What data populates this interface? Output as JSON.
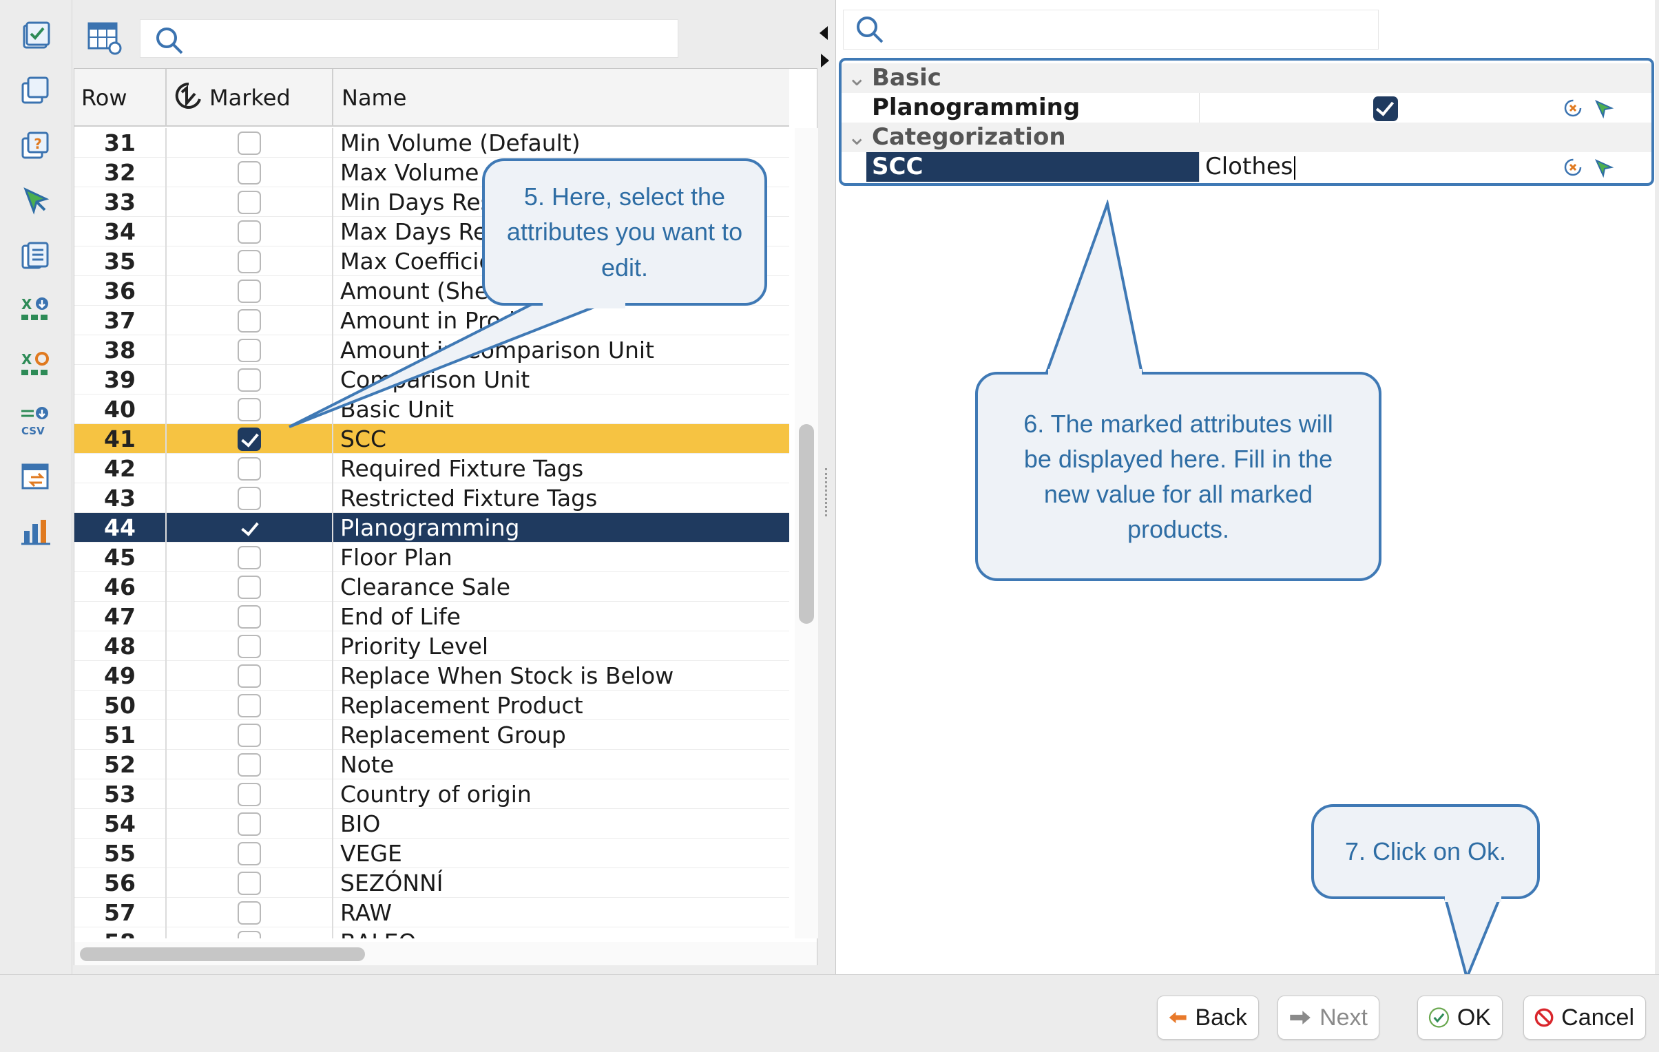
{
  "left_search": {
    "placeholder": ""
  },
  "table": {
    "headers": {
      "row": "Row",
      "marked": "Marked",
      "name": "Name"
    },
    "rows": [
      {
        "row": "31",
        "marked": false,
        "name": "Min Volume (Default)"
      },
      {
        "row": "32",
        "marked": false,
        "name": "Max Volume ("
      },
      {
        "row": "33",
        "marked": false,
        "name": "Min Days Rese"
      },
      {
        "row": "34",
        "marked": false,
        "name": "Max Days Res"
      },
      {
        "row": "35",
        "marked": false,
        "name": "Max Coefficier"
      },
      {
        "row": "36",
        "marked": false,
        "name": "Amount (Shelf"
      },
      {
        "row": "37",
        "marked": false,
        "name": "Amount in Prod"
      },
      {
        "row": "38",
        "marked": false,
        "name": "Amount in Comparison Unit"
      },
      {
        "row": "39",
        "marked": false,
        "name": "Comparison Unit"
      },
      {
        "row": "40",
        "marked": false,
        "name": "Basic Unit"
      },
      {
        "row": "41",
        "marked": true,
        "name": "SCC"
      },
      {
        "row": "42",
        "marked": false,
        "name": "Required Fixture Tags"
      },
      {
        "row": "43",
        "marked": false,
        "name": "Restricted Fixture Tags"
      },
      {
        "row": "44",
        "marked": true,
        "name": "Planogramming"
      },
      {
        "row": "45",
        "marked": false,
        "name": "Floor Plan"
      },
      {
        "row": "46",
        "marked": false,
        "name": "Clearance Sale"
      },
      {
        "row": "47",
        "marked": false,
        "name": "End of Life"
      },
      {
        "row": "48",
        "marked": false,
        "name": "Priority Level"
      },
      {
        "row": "49",
        "marked": false,
        "name": "Replace When Stock is Below"
      },
      {
        "row": "50",
        "marked": false,
        "name": "Replacement Product"
      },
      {
        "row": "51",
        "marked": false,
        "name": "Replacement Group"
      },
      {
        "row": "52",
        "marked": false,
        "name": "Note"
      },
      {
        "row": "53",
        "marked": false,
        "name": "Country of origin"
      },
      {
        "row": "54",
        "marked": false,
        "name": "BIO"
      },
      {
        "row": "55",
        "marked": false,
        "name": "VEGE"
      },
      {
        "row": "56",
        "marked": false,
        "name": "SEZÓNNÍ"
      },
      {
        "row": "57",
        "marked": false,
        "name": "RAW"
      },
      {
        "row": "58",
        "marked": false,
        "name": "BALEO"
      }
    ],
    "highlight_yellow_row": "41",
    "highlight_dark_row": "44"
  },
  "right_search": {
    "placeholder": ""
  },
  "properties": {
    "groups": [
      {
        "label": "Basic",
        "items": [
          {
            "name": "Planogramming",
            "type": "checkbox",
            "checked": true
          }
        ]
      },
      {
        "label": "Categorization",
        "items": [
          {
            "name": "SCC",
            "type": "text",
            "value": "Clothes"
          }
        ]
      }
    ]
  },
  "callouts": {
    "c5": "5. Here, select the attributes you want to edit.",
    "c6": "6. The marked attributes will be displayed here. Fill in the new value for all marked products.",
    "c7": "7. Click on Ok."
  },
  "buttons": {
    "back": "Back",
    "next": "Next",
    "ok": "OK",
    "cancel": "Cancel"
  },
  "colors": {
    "accent_dark": "#1f3a5f",
    "highlight_yellow": "#f6c342",
    "callout_border": "#3f79b5",
    "callout_text": "#2e6da4"
  },
  "icons": {
    "toolbar": [
      "checklist-icon",
      "copy-window-icon",
      "help-window-icon",
      "cursor-select-icon",
      "documents-icon",
      "excel-import-icon",
      "excel-settings-icon",
      "csv-import-icon",
      "table-transfer-icon",
      "bar-chart-icon"
    ],
    "grid_tool": "table-settings-icon",
    "search": "search-icon"
  }
}
